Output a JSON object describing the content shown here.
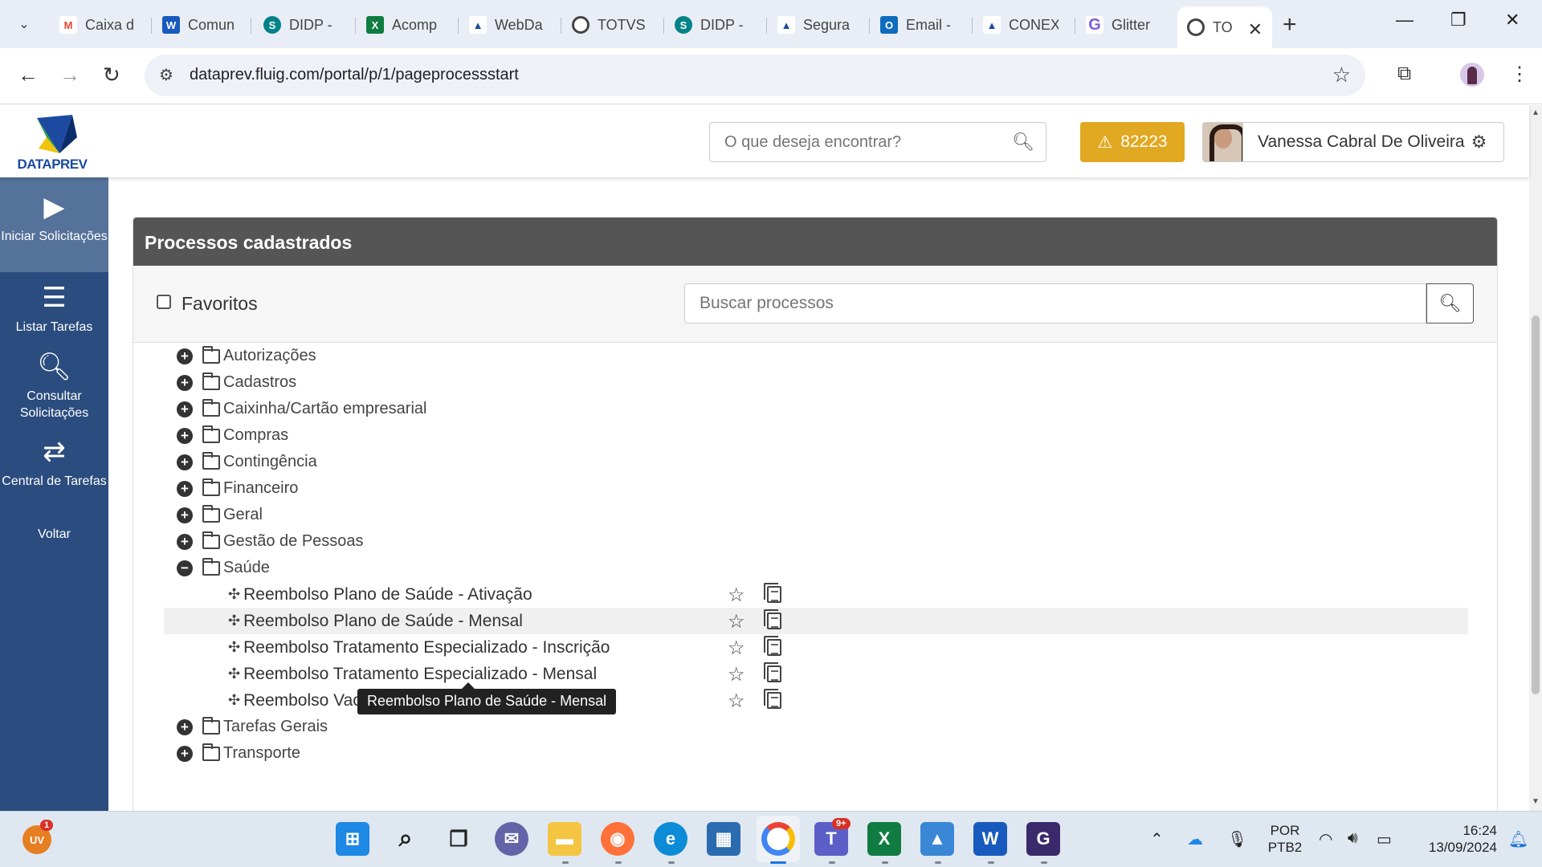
{
  "browser": {
    "tabs": [
      {
        "title": "Caixa d",
        "icon": "gmail-icon",
        "color": "#ea4335",
        "glyph": "M"
      },
      {
        "title": "Comun",
        "icon": "word-icon",
        "color": "#185abd",
        "glyph": "W"
      },
      {
        "title": "DIDP -",
        "icon": "sharepoint-icon",
        "color": "#038387",
        "glyph": "S"
      },
      {
        "title": "Acomp",
        "icon": "excel-icon",
        "color": "#107c41",
        "glyph": "X"
      },
      {
        "title": "WebDa",
        "icon": "dataprev-icon",
        "color": "#1b4aa0",
        "glyph": "▲"
      },
      {
        "title": "TOTVS",
        "icon": "totvs-icon",
        "color": "#333333",
        "glyph": "◎"
      },
      {
        "title": "DIDP -",
        "icon": "sharepoint-icon",
        "color": "#038387",
        "glyph": "S"
      },
      {
        "title": "Segura",
        "icon": "dataprev-icon",
        "color": "#1b4aa0",
        "glyph": "▲"
      },
      {
        "title": "Email -",
        "icon": "outlook-icon",
        "color": "#0f6cbd",
        "glyph": "O"
      },
      {
        "title": "CONEX",
        "icon": "dataprev-icon",
        "color": "#1b4aa0",
        "glyph": "▲"
      },
      {
        "title": "Glitter",
        "icon": "glitter-icon",
        "color": "#7b5cd6",
        "glyph": "G"
      }
    ],
    "active_tab": {
      "title": "TO",
      "icon": "totvs-icon"
    },
    "url": "dataprev.fluig.com/portal/p/1/pageprocessstart"
  },
  "header": {
    "logo_text": "DATAPREV",
    "search_placeholder": "O que deseja encontrar?",
    "alert_count": "82223",
    "user_name": "Vanessa Cabral De Oliveira"
  },
  "sidebar": {
    "items": [
      {
        "label": "Iniciar Solicitações",
        "icon": "play-icon"
      },
      {
        "label": "Listar Tarefas",
        "icon": "task-list-icon"
      },
      {
        "label": "Consultar Solicitações",
        "icon": "search-icon"
      },
      {
        "label": "Central de Tarefas",
        "icon": "transfer-icon"
      },
      {
        "label": "Voltar",
        "icon": ""
      }
    ]
  },
  "panel": {
    "title": "Processos cadastrados",
    "favorites_label": "Favoritos",
    "search_placeholder": "Buscar processos"
  },
  "tree": {
    "folders_before": [
      "Autorizações",
      "Cadastros",
      "Caixinha/Cartão empresarial",
      "Compras",
      "Contingência",
      "Financeiro",
      "Geral",
      "Gestão de Pessoas"
    ],
    "expanded_folder": "Saúde",
    "processes": [
      "Reembolso Plano de Saúde - Ativação",
      "Reembolso Plano de Saúde - Mensal",
      "Reembolso Tratamento Especializado - Inscrição",
      "Reembolso Tratamento Especializado - Mensal",
      "Reembolso Vacina"
    ],
    "folders_after": [
      "Tarefas Gerais",
      "Transporte"
    ],
    "tooltip": "Reembolso Plano de Saúde - Mensal"
  },
  "taskbar": {
    "weather_badge": "1",
    "teams_badge": "9+",
    "language": "POR",
    "layout": "PTB2",
    "time": "16:24",
    "date": "13/09/2024"
  },
  "colors": {
    "sidebar": "#2b4c7e",
    "panel_header": "#555555",
    "alert": "#e1a821"
  }
}
